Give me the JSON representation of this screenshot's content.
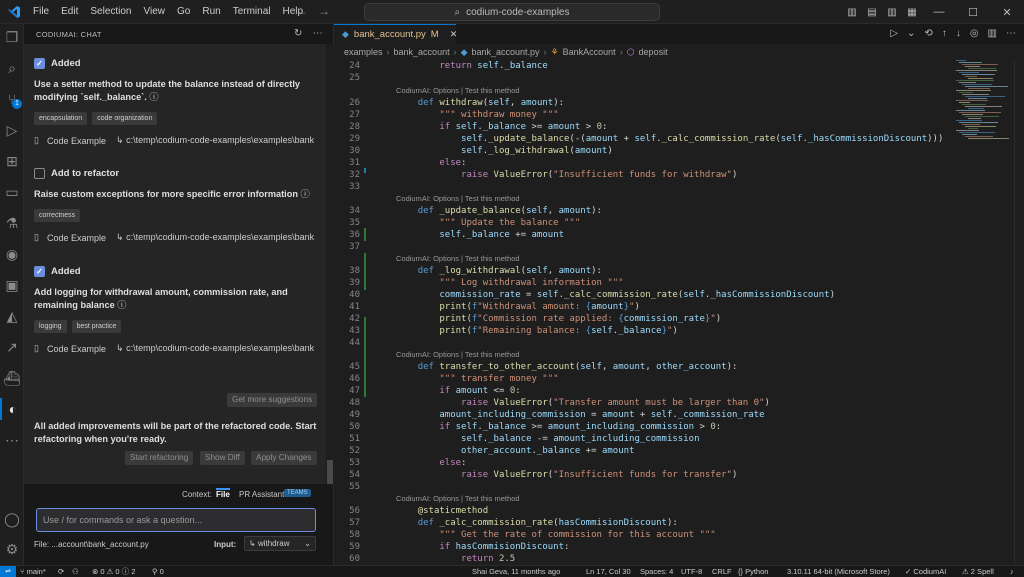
{
  "titlebar": {
    "menu": [
      "File",
      "Edit",
      "Selection",
      "View",
      "Go",
      "Run",
      "Terminal",
      "Help"
    ],
    "search": "codium-code-examples"
  },
  "panel": {
    "header": "CODIUMAI: CHAT",
    "suggestions": [
      {
        "status": "Added",
        "checked": true,
        "title": "Use a setter method to update the balance instead of directly modifying `self._balance`.",
        "tags": [
          "encapsulation",
          "code organization"
        ],
        "example_label": "Code Example",
        "example_path": "c:\\temp\\codium-code-examples\\examples\\bank"
      },
      {
        "status": "Add to refactor",
        "checked": false,
        "title": "Raise custom exceptions for more specific error information",
        "tags": [
          "correctness"
        ],
        "example_label": "Code Example",
        "example_path": "c:\\temp\\codium-code-examples\\examples\\bank"
      },
      {
        "status": "Added",
        "checked": true,
        "title": "Add logging for withdrawal amount, commission rate, and remaining balance",
        "tags": [
          "logging",
          "best practice"
        ],
        "example_label": "Code Example",
        "example_path": "c:\\temp\\codium-code-examples\\examples\\bank"
      }
    ],
    "more_suggestions": "Get more suggestions",
    "note": "All added improvements will be part of the refactored code. Start refactoring when you're ready.",
    "start_refactoring": "Start refactoring",
    "show_diff": "Show Diff",
    "apply_changes": "Apply Changes",
    "context_label": "Context:",
    "context_file": "File",
    "context_pr": "PR Assistant",
    "teams": "TEAMS",
    "input_placeholder": "Use / for commands or ask a question...",
    "file_label": "File: ...account\\bank_account.py",
    "input_label": "Input:",
    "input_value": "withdraw"
  },
  "editor": {
    "tab": "bank_account.py",
    "tab_modified": "M",
    "breadcrumb": [
      "examples",
      "bank_account",
      "bank_account.py",
      "BankAccount",
      "deposit"
    ],
    "lens": "CodiumAI: Options | Test this method"
  },
  "status": {
    "branch": "main*",
    "problems": "⊗ 0 ⚠ 0 ⓘ 2",
    "ports": "⚲ 0",
    "blame": "Shai Geva, 11 months ago",
    "cursor": "Ln 17, Col 30",
    "spaces": "Spaces: 4",
    "encoding": "UTF-8",
    "eol": "CRLF",
    "language": "Python",
    "interpreter": "3.10.11 64-bit (Microsoft Store)",
    "codium": "CodiumAI",
    "spell": "⚠ 2 Spell"
  }
}
